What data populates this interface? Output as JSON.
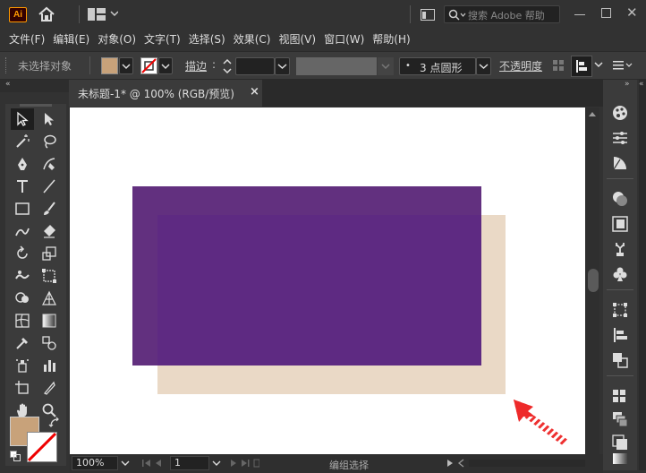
{
  "app": {
    "logo_text": "Ai",
    "search_placeholder": "搜索 Adobe 帮助"
  },
  "menu": [
    "文件(F)",
    "编辑(E)",
    "对象(O)",
    "文字(T)",
    "选择(S)",
    "效果(C)",
    "视图(V)",
    "窗口(W)",
    "帮助(H)"
  ],
  "controlbar": {
    "selection_status": "未选择对象",
    "fill_color": "#c8a27a",
    "stroke_label": "描边",
    "brush_label": "3 点圆形",
    "opacity_label": "不透明度"
  },
  "document": {
    "tab_title": "未标题-1* @ 100% (RGB/预览)",
    "tab_close": "×"
  },
  "artwork": {
    "purple_color": "#5e2a82",
    "beige_color": "#ead9c6",
    "purple_overlay_color": "#62307f"
  },
  "statusbar": {
    "zoom": "100%",
    "artboard": "1",
    "mode": "编组选择"
  },
  "toolbar": {
    "fill_swatch": "#c8a27a"
  }
}
